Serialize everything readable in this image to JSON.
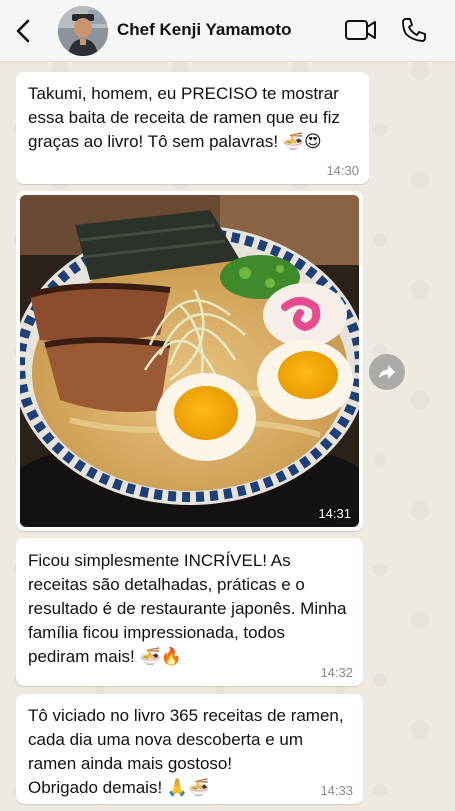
{
  "header": {
    "contact_name": "Chef Kenji Yamamoto",
    "icons": {
      "back": "chevron-left-icon",
      "video": "video-camera-icon",
      "call": "phone-icon"
    }
  },
  "messages": [
    {
      "type": "text",
      "text": "Takumi, homem, eu PRECISO te mostrar essa baita de receita de ramen que eu fiz graças ao livro! Tô sem palavras! 🍜😍",
      "time": "14:30"
    },
    {
      "type": "image",
      "image_subject": "ramen bowl with chashu pork, soft-boiled egg halves, nori, narutomaki and scallions",
      "time": "14:31"
    },
    {
      "type": "text",
      "text": "Ficou simplesmente INCRÍVEL! As receitas são detalhadas, práticas e o resultado é de restaurante japonês. Minha família ficou impressionada, todos pediram mais! 🍜🔥",
      "time": "14:32"
    },
    {
      "type": "text",
      "text": "Tô viciado no livro 365 receitas de ramen, cada dia uma nova descoberta e um ramen ainda mais gostoso!\nObrigado demais! 🙏🍜",
      "time": "14:33"
    }
  ],
  "colors": {
    "chat_background": "#efeae2",
    "bubble": "#ffffff",
    "header": "#f6f6f6",
    "timestamp": "#8a8a8a"
  }
}
